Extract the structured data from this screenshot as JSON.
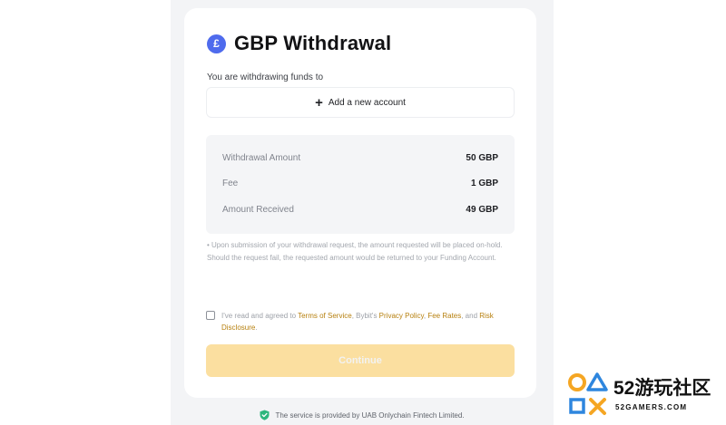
{
  "header": {
    "currency_symbol": "£",
    "title": "GBP Withdrawal",
    "subtitle": "You are withdrawing funds to"
  },
  "account": {
    "add_label": "Add a new account"
  },
  "summary": {
    "rows": [
      {
        "label": "Withdrawal Amount",
        "value": "50 GBP"
      },
      {
        "label": "Fee",
        "value": "1 GBP"
      },
      {
        "label": "Amount Received",
        "value": "49 GBP"
      }
    ]
  },
  "note": "• Upon submission of your withdrawal request, the amount requested will be placed on-hold. Should the request fail, the requested amount would be returned to your Funding Account.",
  "agreement": {
    "checked": false,
    "prefix": "I've read and agreed to ",
    "terms": "Terms of Service",
    "mid1": ", Bybit's ",
    "privacy": "Privacy Policy",
    "mid2": ", ",
    "fees": "Fee Rates",
    "mid3": ", and ",
    "risk": "Risk Disclosure",
    "suffix": "."
  },
  "continue_label": "Continue",
  "footer_text": "The service is provided by UAB Onlychain Fintech Limited.",
  "watermark": {
    "big": "52游玩社区",
    "small": "52GAMERS.COM"
  },
  "colors": {
    "accent": "#4f6bed",
    "link": "#b7800f",
    "continue_bg": "#fbdfa0",
    "shield": "#2eb67d"
  },
  "icons": [
    "pound-currency-icon",
    "plus-icon",
    "checkbox-icon",
    "shield-check-icon"
  ]
}
